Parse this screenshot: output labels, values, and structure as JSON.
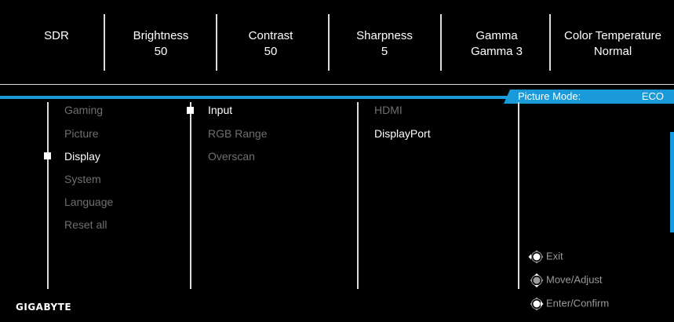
{
  "status_bar": {
    "mode": "SDR",
    "items": [
      {
        "label": "Brightness",
        "value": "50"
      },
      {
        "label": "Contrast",
        "value": "50"
      },
      {
        "label": "Sharpness",
        "value": "5"
      },
      {
        "label": "Gamma",
        "value": "Gamma 3"
      },
      {
        "label": "Color Temperature",
        "value": "Normal"
      }
    ]
  },
  "picture_mode": {
    "label": "Picture Mode:",
    "value": "ECO"
  },
  "main_menu": {
    "items": [
      "Gaming",
      "Picture",
      "Display",
      "System",
      "Language",
      "Reset all"
    ],
    "selected": "Display"
  },
  "sub_menu": {
    "items": [
      "Input",
      "RGB Range",
      "Overscan"
    ],
    "selected": "Input"
  },
  "options": {
    "items": [
      "HDMI",
      "DisplayPort"
    ],
    "selected": "DisplayPort"
  },
  "hints": [
    {
      "icon": "joystick-left-icon",
      "label": "Exit"
    },
    {
      "icon": "joystick-updown-icon",
      "label": "Move/Adjust"
    },
    {
      "icon": "joystick-press-icon",
      "label": "Enter/Confirm"
    }
  ],
  "brand": "GIGABYTE",
  "colors": {
    "accent": "#1a9ad8",
    "background": "#000000",
    "inactive_text": "#6f6f6f"
  }
}
